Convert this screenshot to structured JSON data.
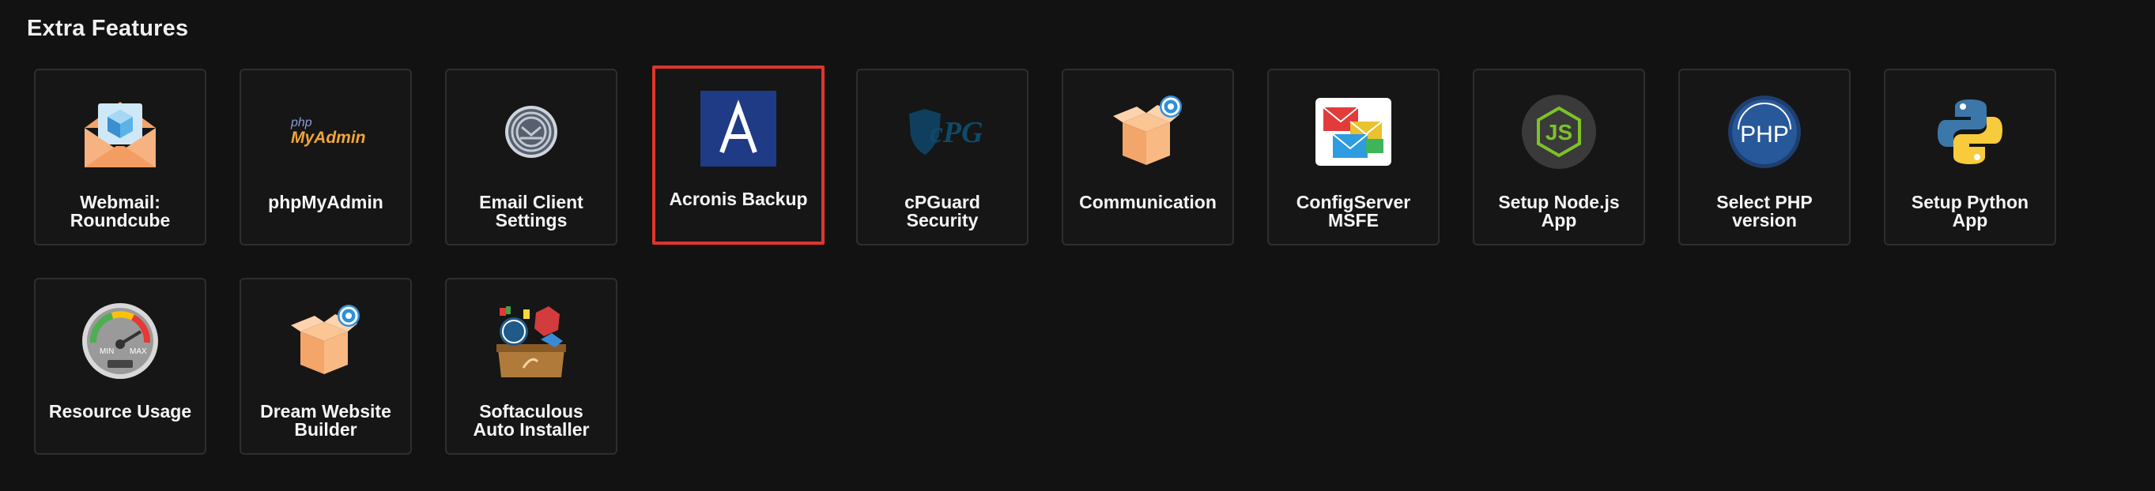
{
  "section": {
    "title": "Extra Features"
  },
  "tiles": [
    {
      "label": "Webmail:\nRoundcube",
      "icon": "envelope-box-icon"
    },
    {
      "label": "phpMyAdmin",
      "icon": "phpmyadmin-icon",
      "logo_top": "php",
      "logo_bottom": "MyAdmin"
    },
    {
      "label": "Email Client\nSettings",
      "icon": "email-client-icon"
    },
    {
      "label": "Acronis Backup",
      "icon": "acronis-icon",
      "selected": true
    },
    {
      "label": "cPGuard\nSecurity",
      "icon": "cpguard-icon",
      "logo": "cPG"
    },
    {
      "label": "Communication",
      "icon": "box-gear-icon"
    },
    {
      "label": "ConfigServer\nMSFE",
      "icon": "envelopes-icon"
    },
    {
      "label": "Setup Node.js\nApp",
      "icon": "nodejs-icon",
      "logo": "JS"
    },
    {
      "label": "Select PHP\nversion",
      "icon": "php-icon",
      "logo": "PHP"
    },
    {
      "label": "Setup Python\nApp",
      "icon": "python-icon"
    },
    {
      "label": "Resource Usage",
      "icon": "gauge-icon",
      "min": "MIN",
      "max": "MAX"
    },
    {
      "label": "Dream Website\nBuilder",
      "icon": "box-gear-icon"
    },
    {
      "label": "Softaculous\nAuto Installer",
      "icon": "softaculous-icon"
    }
  ],
  "colors": {
    "accent_selected": "#e0352b",
    "tile_border": "#2e2e2e",
    "background": "#121212"
  }
}
